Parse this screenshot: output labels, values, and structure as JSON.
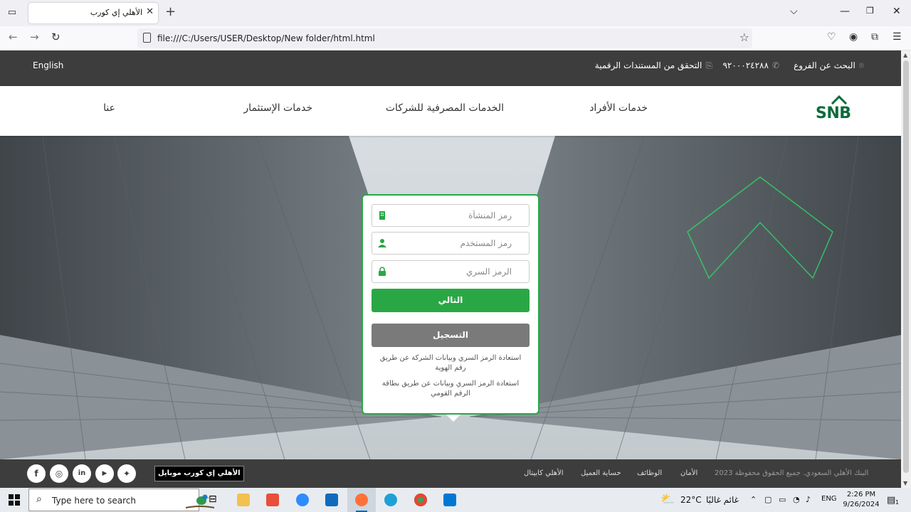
{
  "browser": {
    "tab_title": "الأهلي إي كورب",
    "url": "file:///C:/Users/USER/Desktop/New folder/html.html"
  },
  "topbar": {
    "language": "English",
    "phone": "٩٢٠٠٠٢٤٢٨٨",
    "verify_documents": "التحقق من المستندات الرقمية",
    "branch_search": "البحث عن الفروع"
  },
  "nav": {
    "logo": "SNB",
    "items": [
      "خدمات الأفراد",
      "الخدمات المصرفية للشركات",
      "خدمات الإستثمار",
      "عنا"
    ]
  },
  "login": {
    "org_code_placeholder": "رمز المنشأة",
    "user_code_placeholder": "رمز المستخدم",
    "password_placeholder": "الرمز السري",
    "next_button": "التالي",
    "register_button": "التسجيل",
    "recover_by_id": "استعادة الرمز السري وبيانات الشركة عن طريق رقم الهوية",
    "recover_by_national_card": "استعادة الرمز السري وبيانات عن طريق بطاقة الرقم القومي"
  },
  "footer": {
    "copyright": "البنك الأهلي السعودي. جميع الحقوق محفوظة 2023",
    "links": [
      "الأمان",
      "الوظائف",
      "حساية العميل",
      "الأهلي كابيتال"
    ],
    "mobile_app": "الأهلي إي كورب موبايل",
    "social": [
      "facebook",
      "instagram",
      "linkedin",
      "youtube",
      "twitter"
    ]
  },
  "taskbar": {
    "search_placeholder": "Type here to search",
    "weather_temp": "22°C",
    "weather_desc": "غائم غالبًا",
    "language": "ENG",
    "time": "2:26 PM",
    "date": "9/26/2024",
    "notification_count": "1"
  },
  "colors": {
    "brand_green": "#2aa745",
    "logo_green": "#0b6b3a",
    "dark_bar": "#3d3d3d"
  }
}
